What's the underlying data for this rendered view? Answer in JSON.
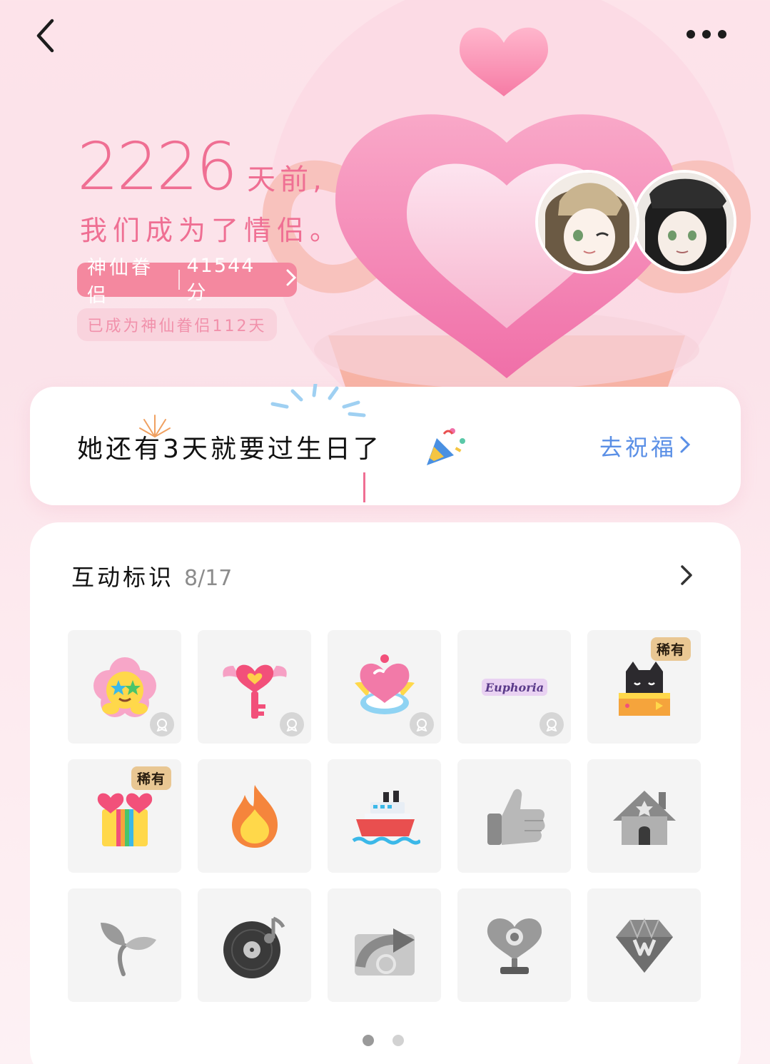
{
  "header": {
    "back_icon": "chevron-left-icon",
    "more_icon": "more-horizontal-icon"
  },
  "relationship": {
    "days": "2226",
    "days_suffix": "天前,",
    "subtitle": "我们成为了情侣。",
    "level_name": "神仙眷侣",
    "score": "41544 分",
    "level_duration": "已成为神仙眷侣112天"
  },
  "birthday": {
    "text": "她还有3天就要过生日了",
    "action_label": "去祝福"
  },
  "badges": {
    "title": "互动标识",
    "count": "8/17",
    "rare_label": "稀有",
    "items": [
      {
        "icon": "starry-eyed-flower-icon",
        "active": true,
        "rare": false,
        "worn": true
      },
      {
        "icon": "heart-key-icon",
        "active": true,
        "rare": false,
        "worn": true
      },
      {
        "icon": "heart-crown-icon",
        "active": true,
        "rare": false,
        "worn": true
      },
      {
        "icon": "euphoria-logo-icon",
        "active": true,
        "rare": false,
        "worn": true,
        "text": "Euphoria"
      },
      {
        "icon": "black-cat-box-icon",
        "active": true,
        "rare": true,
        "worn": false
      },
      {
        "icon": "rainbow-gift-box-icon",
        "active": true,
        "rare": true,
        "worn": false
      },
      {
        "icon": "flame-icon",
        "active": true,
        "rare": false,
        "worn": false
      },
      {
        "icon": "cruise-ship-icon",
        "active": true,
        "rare": false,
        "worn": false
      },
      {
        "icon": "thumbs-up-icon",
        "active": false,
        "rare": false,
        "worn": false
      },
      {
        "icon": "qzone-house-icon",
        "active": false,
        "rare": false,
        "worn": false
      },
      {
        "icon": "sprout-icon",
        "active": false,
        "rare": false,
        "worn": false
      },
      {
        "icon": "music-record-icon",
        "active": false,
        "rare": false,
        "worn": false
      },
      {
        "icon": "share-arrow-icon",
        "active": false,
        "rare": false,
        "worn": false
      },
      {
        "icon": "heart-trophy-icon",
        "active": false,
        "rare": false,
        "worn": false
      },
      {
        "icon": "diamond-gem-icon",
        "active": false,
        "rare": false,
        "worn": false
      }
    ]
  },
  "pager": {
    "pages": 2,
    "current": 1
  },
  "colors": {
    "accent_pink": "#ef6f93",
    "link_blue": "#5a8fe6",
    "pill_pink": "#f4889f"
  }
}
